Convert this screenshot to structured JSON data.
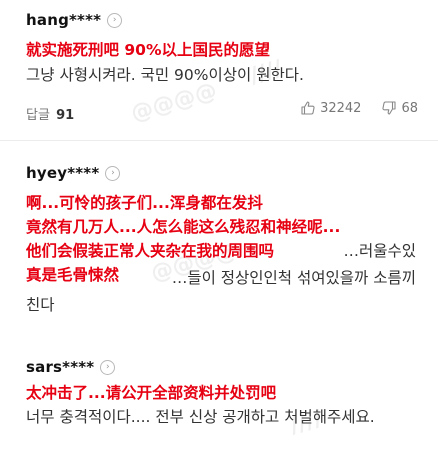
{
  "comments": [
    {
      "username": "hang****",
      "overlay": [
        "就实施死刑吧 90%以上国民的愿望"
      ],
      "text": "그냥 사형시켜라. 국민 90%이상이 원한다.",
      "reply_label": "답글",
      "reply_count": "91",
      "likes": "32242",
      "dislikes": "68"
    },
    {
      "username": "hyey****",
      "overlay": [
        "啊...可怜的孩子们...浑身都在发抖",
        "竟然有几万人...人怎么能这么残忍和神经呢...",
        "他们会假装正常人夹杂在我的周围吗",
        "真是毛骨悚然"
      ],
      "text_line1": "…러울수있",
      "text_line2": "…들이 정상인인척 섞여있을까 소름끼",
      "text_line3": "친다"
    },
    {
      "username": "sars****",
      "overlay": [
        "太冲击了...请公开全部资料并处罚吧"
      ],
      "text": "너무 충격적이다.... 전부 신상 공개하고 처벌해주세요."
    }
  ],
  "icons": {
    "chevron": "chevron-right-icon",
    "thumbs_up": "thumbs-up-icon",
    "thumbs_down": "thumbs-down-icon"
  },
  "colors": {
    "overlay_red": "#e60012",
    "text": "#333333",
    "muted": "#777777"
  }
}
